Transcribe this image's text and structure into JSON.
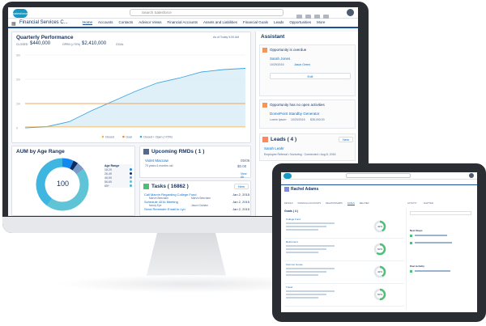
{
  "topbar": {
    "logo": "salesforce",
    "search_placeholder": "Search Salesforce"
  },
  "nav": {
    "app_name": "Financial Services C...",
    "items": [
      "Home",
      "Accounts",
      "Contacts",
      "Advisor Views",
      "Financial Accounts",
      "Assets and Liabilities",
      "Financial Goals",
      "Leads",
      "Opportunities",
      "More"
    ]
  },
  "performance": {
    "title": "Quarterly Performance",
    "closed_label": "CLOSED",
    "closed_value": "$440,000",
    "open_label": "OPEN (>70%)",
    "open_value": "$2,410,000",
    "goal_label": "GOAL",
    "as_of": "As of Today 9:00 AM",
    "y_ticks": [
      "3m",
      "2m",
      "1m",
      "0"
    ],
    "legend": [
      "Closed",
      "Goal",
      "Closed + Open (>70%)"
    ]
  },
  "chart_data": {
    "type": "line",
    "title": "Quarterly Performance",
    "series": [
      {
        "name": "Closed + Open (>70%)",
        "values": [
          0.0,
          0.05,
          0.25,
          0.7,
          1.1,
          1.5,
          1.85,
          2.05,
          2.3,
          2.4,
          2.45
        ]
      },
      {
        "name": "Goal",
        "values": [
          1.0,
          1.0,
          1.0,
          1.0,
          1.0,
          1.0,
          1.0,
          1.0,
          1.0,
          1.0,
          1.0
        ]
      },
      {
        "name": "Closed",
        "values": [
          0.05,
          0.05,
          0.05,
          0.05,
          0.05,
          0.05,
          0.05,
          0.05,
          0.05,
          0.05,
          0.05
        ]
      }
    ],
    "ylim": [
      0,
      3
    ]
  },
  "aum": {
    "title": "AUM by Age Range",
    "center_value": "100",
    "legend_title": "Age Range",
    "ranges": [
      "18-25",
      "26-45",
      "46-55",
      "56-65",
      "65+"
    ],
    "colors": [
      "#1589ee",
      "#0b2d63",
      "#7a9bc7",
      "#5ec4d6",
      "#3fb6e0"
    ],
    "fractions": [
      0.07,
      0.03,
      0.05,
      0.45,
      0.4
    ]
  },
  "rmd": {
    "title": "Upcoming RMDs ( 1 )",
    "name": "Violet Maccaw",
    "date": "05/06",
    "sub": "70 years 6 months old",
    "amount": "$0.00",
    "view_all": "View All"
  },
  "tasks": {
    "title": "Tasks ( 16862 )",
    "new_label": "New",
    "items": [
      {
        "title": "Call Marvin Regarding College Fund",
        "who": "Marvin Beecham",
        "date": "Jan 2, 2015",
        "extra": "Marvin Beecham"
      },
      {
        "title": "Schedule 401k Meeting",
        "who": "Nancy Eye",
        "date": "Jan 2, 2015",
        "extra": "Jason Graham"
      },
      {
        "title": "Send Reminder Email to Lyn",
        "who": "",
        "date": "Jan 2, 2015",
        "extra": ""
      }
    ]
  },
  "assistant": {
    "title": "Assistant",
    "alert1": "Opportunity is overdue",
    "alert1_name": "Sarah Jones",
    "alert1_date": "10/29/2016",
    "alert1_owner": "Jason Green",
    "alert1_button": "Edit",
    "alert2": "Opportunity has no open activities",
    "alert2_name": "DomePoint Standby Generator",
    "alert2_person": "Lorem Ipsum",
    "alert2_date": "10/23/2016",
    "alert2_amount": "$35,000.00",
    "leads_title": "Leads ( 4 )",
    "leads_new": "New",
    "lead_name": "Sarah Leahr",
    "lead_detail": "Employee Referral • Nurturing · Connected • Aug 8, 2016"
  },
  "tablet": {
    "title": "Rachel Adams",
    "tabs": [
      "DETAILS",
      "FINANCIAL ACCOUNTS",
      "RELATIONSHIPS",
      "GOALS",
      "RELATED"
    ],
    "right_tabs": [
      "ACTIVITY",
      "CHATTER"
    ],
    "goals_header": "Goals ( 4 )",
    "goals": [
      {
        "name": "College Fund",
        "pct": 0.42
      },
      {
        "name": "Retirement",
        "pct": 0.6
      },
      {
        "name": "Summer House",
        "pct": 0.42
      },
      {
        "name": "Travel",
        "pct": 0.5
      }
    ],
    "pct_labels": [
      "42%",
      "60%",
      "42%",
      "50%"
    ],
    "next_steps": "Next Steps",
    "past_activity": "Past Activity"
  },
  "colors": {
    "primary": "#1b5297",
    "accent": "#1798c1",
    "bg": "#f4f6f9",
    "monitor": "#2a2d31",
    "chart_line": "#3fa4e0",
    "goal_line": "#f08a24"
  }
}
